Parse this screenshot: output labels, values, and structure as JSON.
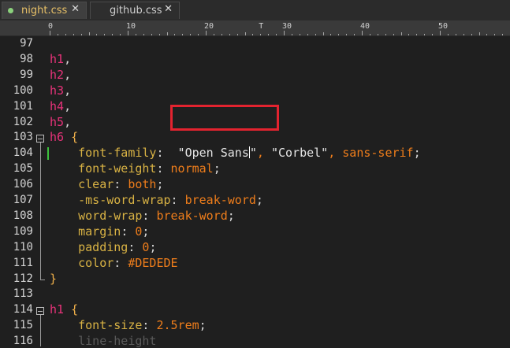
{
  "tabs": [
    {
      "label": "night.css",
      "close": "✕",
      "active": true
    },
    {
      "label": "github.css",
      "close": "✕",
      "active": false
    }
  ],
  "ruler": {
    "labels": [
      "0",
      "10",
      "20",
      "T",
      "30",
      "40",
      "50"
    ]
  },
  "lines": [
    {
      "num": "97"
    },
    {
      "num": "98",
      "tokens": [
        {
          "t": "h1",
          "c": "sel"
        },
        {
          "t": ",",
          "c": "punct"
        }
      ]
    },
    {
      "num": "99",
      "tokens": [
        {
          "t": "h2",
          "c": "sel"
        },
        {
          "t": ",",
          "c": "punct"
        }
      ]
    },
    {
      "num": "100",
      "tokens": [
        {
          "t": "h3",
          "c": "sel"
        },
        {
          "t": ",",
          "c": "punct"
        }
      ]
    },
    {
      "num": "101",
      "tokens": [
        {
          "t": "h4",
          "c": "sel"
        },
        {
          "t": ",",
          "c": "punct"
        }
      ]
    },
    {
      "num": "102",
      "tokens": [
        {
          "t": "h5",
          "c": "sel"
        },
        {
          "t": ",",
          "c": "punct"
        }
      ]
    },
    {
      "num": "103",
      "tokens": [
        {
          "t": "h6",
          "c": "sel"
        },
        {
          "t": " ",
          "c": "punct"
        },
        {
          "t": "{",
          "c": "brace"
        }
      ]
    },
    {
      "num": "104",
      "tokens": [
        {
          "t": "    font-family",
          "c": "prop"
        },
        {
          "t": ":",
          "c": "punct"
        },
        {
          "t": "  \"Open Sans",
          "c": "str"
        },
        {
          "t": "CARET",
          "c": "caret"
        },
        {
          "t": "\"",
          "c": "str"
        },
        {
          "t": ",",
          "c": "comma"
        },
        {
          "t": " \"Corbel\"",
          "c": "str"
        },
        {
          "t": ",",
          "c": "comma"
        },
        {
          "t": " sans-serif",
          "c": "val"
        },
        {
          "t": ";",
          "c": "punct"
        }
      ]
    },
    {
      "num": "105",
      "tokens": [
        {
          "t": "    font-weight",
          "c": "prop"
        },
        {
          "t": ":",
          "c": "punct"
        },
        {
          "t": " normal",
          "c": "val"
        },
        {
          "t": ";",
          "c": "punct"
        }
      ]
    },
    {
      "num": "106",
      "tokens": [
        {
          "t": "    clear",
          "c": "prop"
        },
        {
          "t": ":",
          "c": "punct"
        },
        {
          "t": " both",
          "c": "val"
        },
        {
          "t": ";",
          "c": "punct"
        }
      ]
    },
    {
      "num": "107",
      "tokens": [
        {
          "t": "    -ms-word-wrap",
          "c": "prop"
        },
        {
          "t": ":",
          "c": "punct"
        },
        {
          "t": " break-word",
          "c": "val"
        },
        {
          "t": ";",
          "c": "punct"
        }
      ]
    },
    {
      "num": "108",
      "tokens": [
        {
          "t": "    word-wrap",
          "c": "prop"
        },
        {
          "t": ":",
          "c": "punct"
        },
        {
          "t": " break-word",
          "c": "val"
        },
        {
          "t": ";",
          "c": "punct"
        }
      ]
    },
    {
      "num": "109",
      "tokens": [
        {
          "t": "    margin",
          "c": "prop"
        },
        {
          "t": ":",
          "c": "punct"
        },
        {
          "t": " 0",
          "c": "val"
        },
        {
          "t": ";",
          "c": "punct"
        }
      ]
    },
    {
      "num": "110",
      "tokens": [
        {
          "t": "    padding",
          "c": "prop"
        },
        {
          "t": ":",
          "c": "punct"
        },
        {
          "t": " 0",
          "c": "val"
        },
        {
          "t": ";",
          "c": "punct"
        }
      ]
    },
    {
      "num": "111",
      "tokens": [
        {
          "t": "    color",
          "c": "prop"
        },
        {
          "t": ":",
          "c": "punct"
        },
        {
          "t": " #DEDEDE",
          "c": "val"
        }
      ]
    },
    {
      "num": "112",
      "tokens": [
        {
          "t": "}",
          "c": "brace"
        }
      ]
    },
    {
      "num": "113"
    },
    {
      "num": "114",
      "tokens": [
        {
          "t": "h1",
          "c": "sel"
        },
        {
          "t": " ",
          "c": "punct"
        },
        {
          "t": "{",
          "c": "brace"
        }
      ]
    },
    {
      "num": "115",
      "tokens": [
        {
          "t": "    font-size",
          "c": "prop"
        },
        {
          "t": ":",
          "c": "punct"
        },
        {
          "t": " 2.5rem",
          "c": "val"
        },
        {
          "t": ";",
          "c": "punct"
        }
      ]
    },
    {
      "num": "116",
      "tokens": [
        {
          "t": "    line-height",
          "c": "dim"
        }
      ]
    }
  ]
}
